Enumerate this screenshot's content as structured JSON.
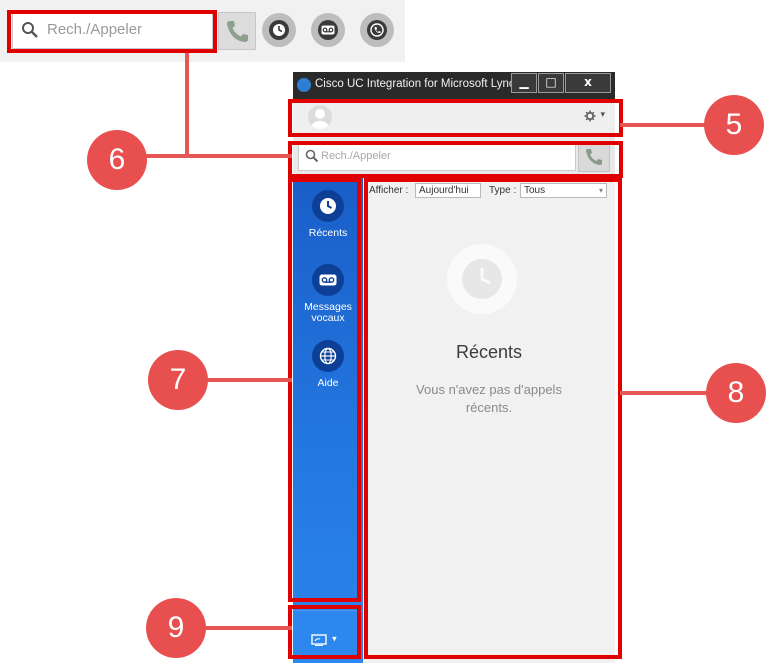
{
  "top_search": {
    "placeholder": "Rech./Appeler"
  },
  "window": {
    "title": "Cisco UC Integration for Microsoft Lync",
    "buttons": {
      "minimize": "▁",
      "maximize": "□",
      "close": "x"
    }
  },
  "profile_bar": {
    "settings_caret": "▾"
  },
  "search": {
    "placeholder": "Rech./Appeler"
  },
  "sidebar": {
    "items": [
      {
        "label": "Récents",
        "icon": "clock-icon"
      },
      {
        "label": "Messages\nvocaux",
        "icon": "voicemail-icon"
      },
      {
        "label": "Aide",
        "icon": "globe-icon"
      }
    ],
    "bottom_caret": "▾"
  },
  "content": {
    "filter": {
      "show_label": "Afficher :",
      "show_value": "Aujourd'hui",
      "type_label": "Type :",
      "type_value": "Tous",
      "dropdown_arrow": "▾"
    },
    "empty_title": "Récents",
    "empty_message": "Vous n'avez pas d'appels récents."
  },
  "callouts": [
    "5",
    "6",
    "7",
    "8",
    "9"
  ],
  "colors": {
    "sidebar": "#1a5ec8",
    "accent": "#2d7dd2",
    "annotation": "#e00000",
    "callout": "#e8504f"
  }
}
